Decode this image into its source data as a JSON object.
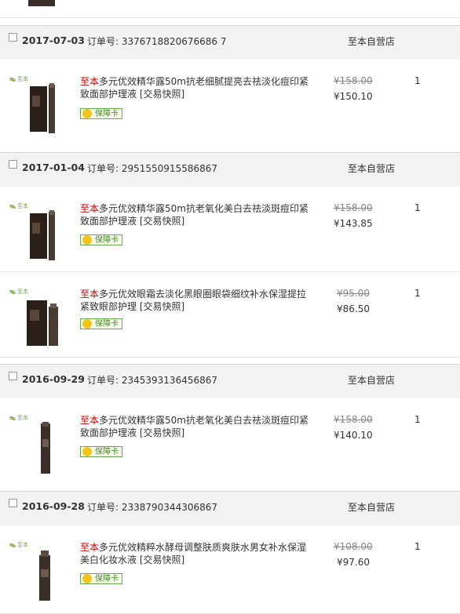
{
  "orders": [
    {
      "date": "2017-07-03",
      "order_no": "订单号: 3376718820676686 7",
      "shop": "至本自营店",
      "items": [
        {
          "brand": "至本",
          "title": "多元优效精华露50m抗老细腻提亮去祛淡化痘印紧致面部护理液",
          "snapshot": "[交易快照]",
          "badge": "保障卡",
          "price_old": "¥158.00",
          "price_new": "¥150.10",
          "qty": "1"
        }
      ]
    },
    {
      "date": "2017-01-04",
      "order_no": "订单号: 2951550915586867",
      "shop": "至本自营店",
      "items": [
        {
          "brand": "至本",
          "title": "多元优效精华露50m抗老氧化美白去祛淡斑痘印紧致面部护理液",
          "snapshot": "[交易快照]",
          "badge": "保障卡",
          "price_old": "¥158.00",
          "price_new": "¥143.85",
          "qty": "1"
        },
        {
          "brand": "至本",
          "title": "多元优效眼霜去淡化黑眼圈眼袋细纹补水保湿提拉紧致眼部护理",
          "snapshot": "[交易快照]",
          "badge": "保障卡",
          "price_old": "¥95.00",
          "price_new": "¥86.50",
          "qty": "1"
        }
      ]
    },
    {
      "date": "2016-09-29",
      "order_no": "订单号: 2345393136456867",
      "shop": "至本自营店",
      "items": [
        {
          "brand": "至本",
          "title": "多元优效精华露50m抗老氧化美白去祛淡斑痘印紧致面部护理液",
          "snapshot": "[交易快照]",
          "badge": "保障卡",
          "price_old": "¥158.00",
          "price_new": "¥140.10",
          "qty": "1"
        }
      ]
    },
    {
      "date": "2016-09-28",
      "order_no": "订单号: 2338790344306867",
      "shop": "至本自营店",
      "items": [
        {
          "brand": "至本",
          "title": "多元优效精粹水酵母调整肤质爽肤水男女补水保湿美白化妆水液",
          "snapshot": "[交易快照]",
          "badge": "保障卡",
          "price_old": "¥108.00",
          "price_new": "¥97.60",
          "qty": "1"
        }
      ]
    }
  ],
  "logo_text": "至本",
  "colors": {
    "brand_red": "#cc0000",
    "header_bg": "#f2f2f2",
    "badge_green": "#3d8f1f",
    "product_dark": "#3a2e27"
  }
}
